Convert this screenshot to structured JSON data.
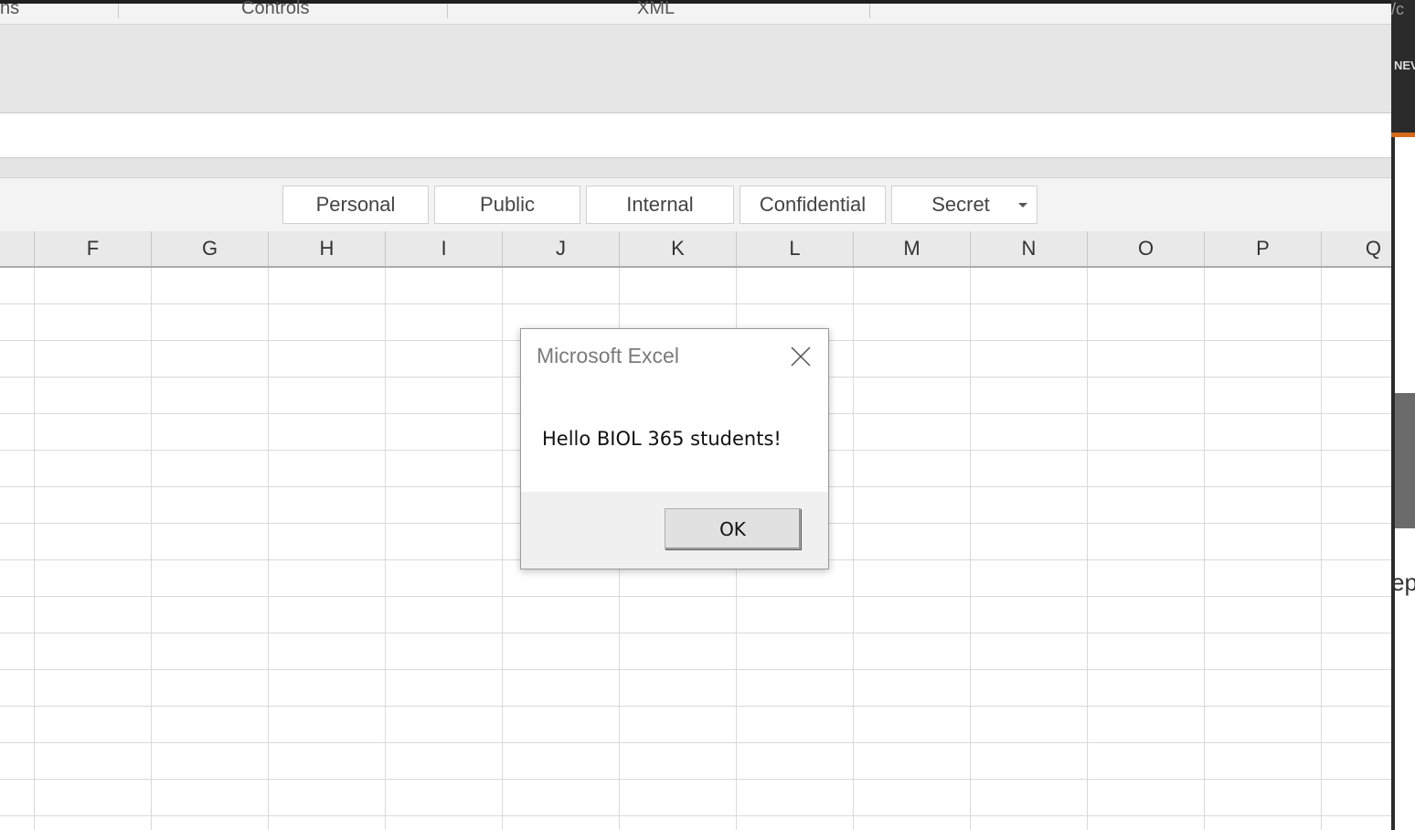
{
  "ribbon": {
    "groups": [
      "ns",
      "Controls",
      "XML"
    ]
  },
  "sensitivity": {
    "labels": [
      "Personal",
      "Public",
      "Internal",
      "Confidential",
      "Secret"
    ]
  },
  "columns": [
    "F",
    "G",
    "H",
    "I",
    "J",
    "K",
    "L",
    "M",
    "N",
    "O",
    "P",
    "Q"
  ],
  "right_edge": {
    "top_text": "/c",
    "new_text": "NEV",
    "partial_text": "ep"
  },
  "dialog": {
    "title": "Microsoft Excel",
    "message": "Hello BIOL 365 students!",
    "ok_label": "OK"
  },
  "colors": {
    "accent_orange": "#d86a1c",
    "window_dark": "#2b2b2b"
  }
}
